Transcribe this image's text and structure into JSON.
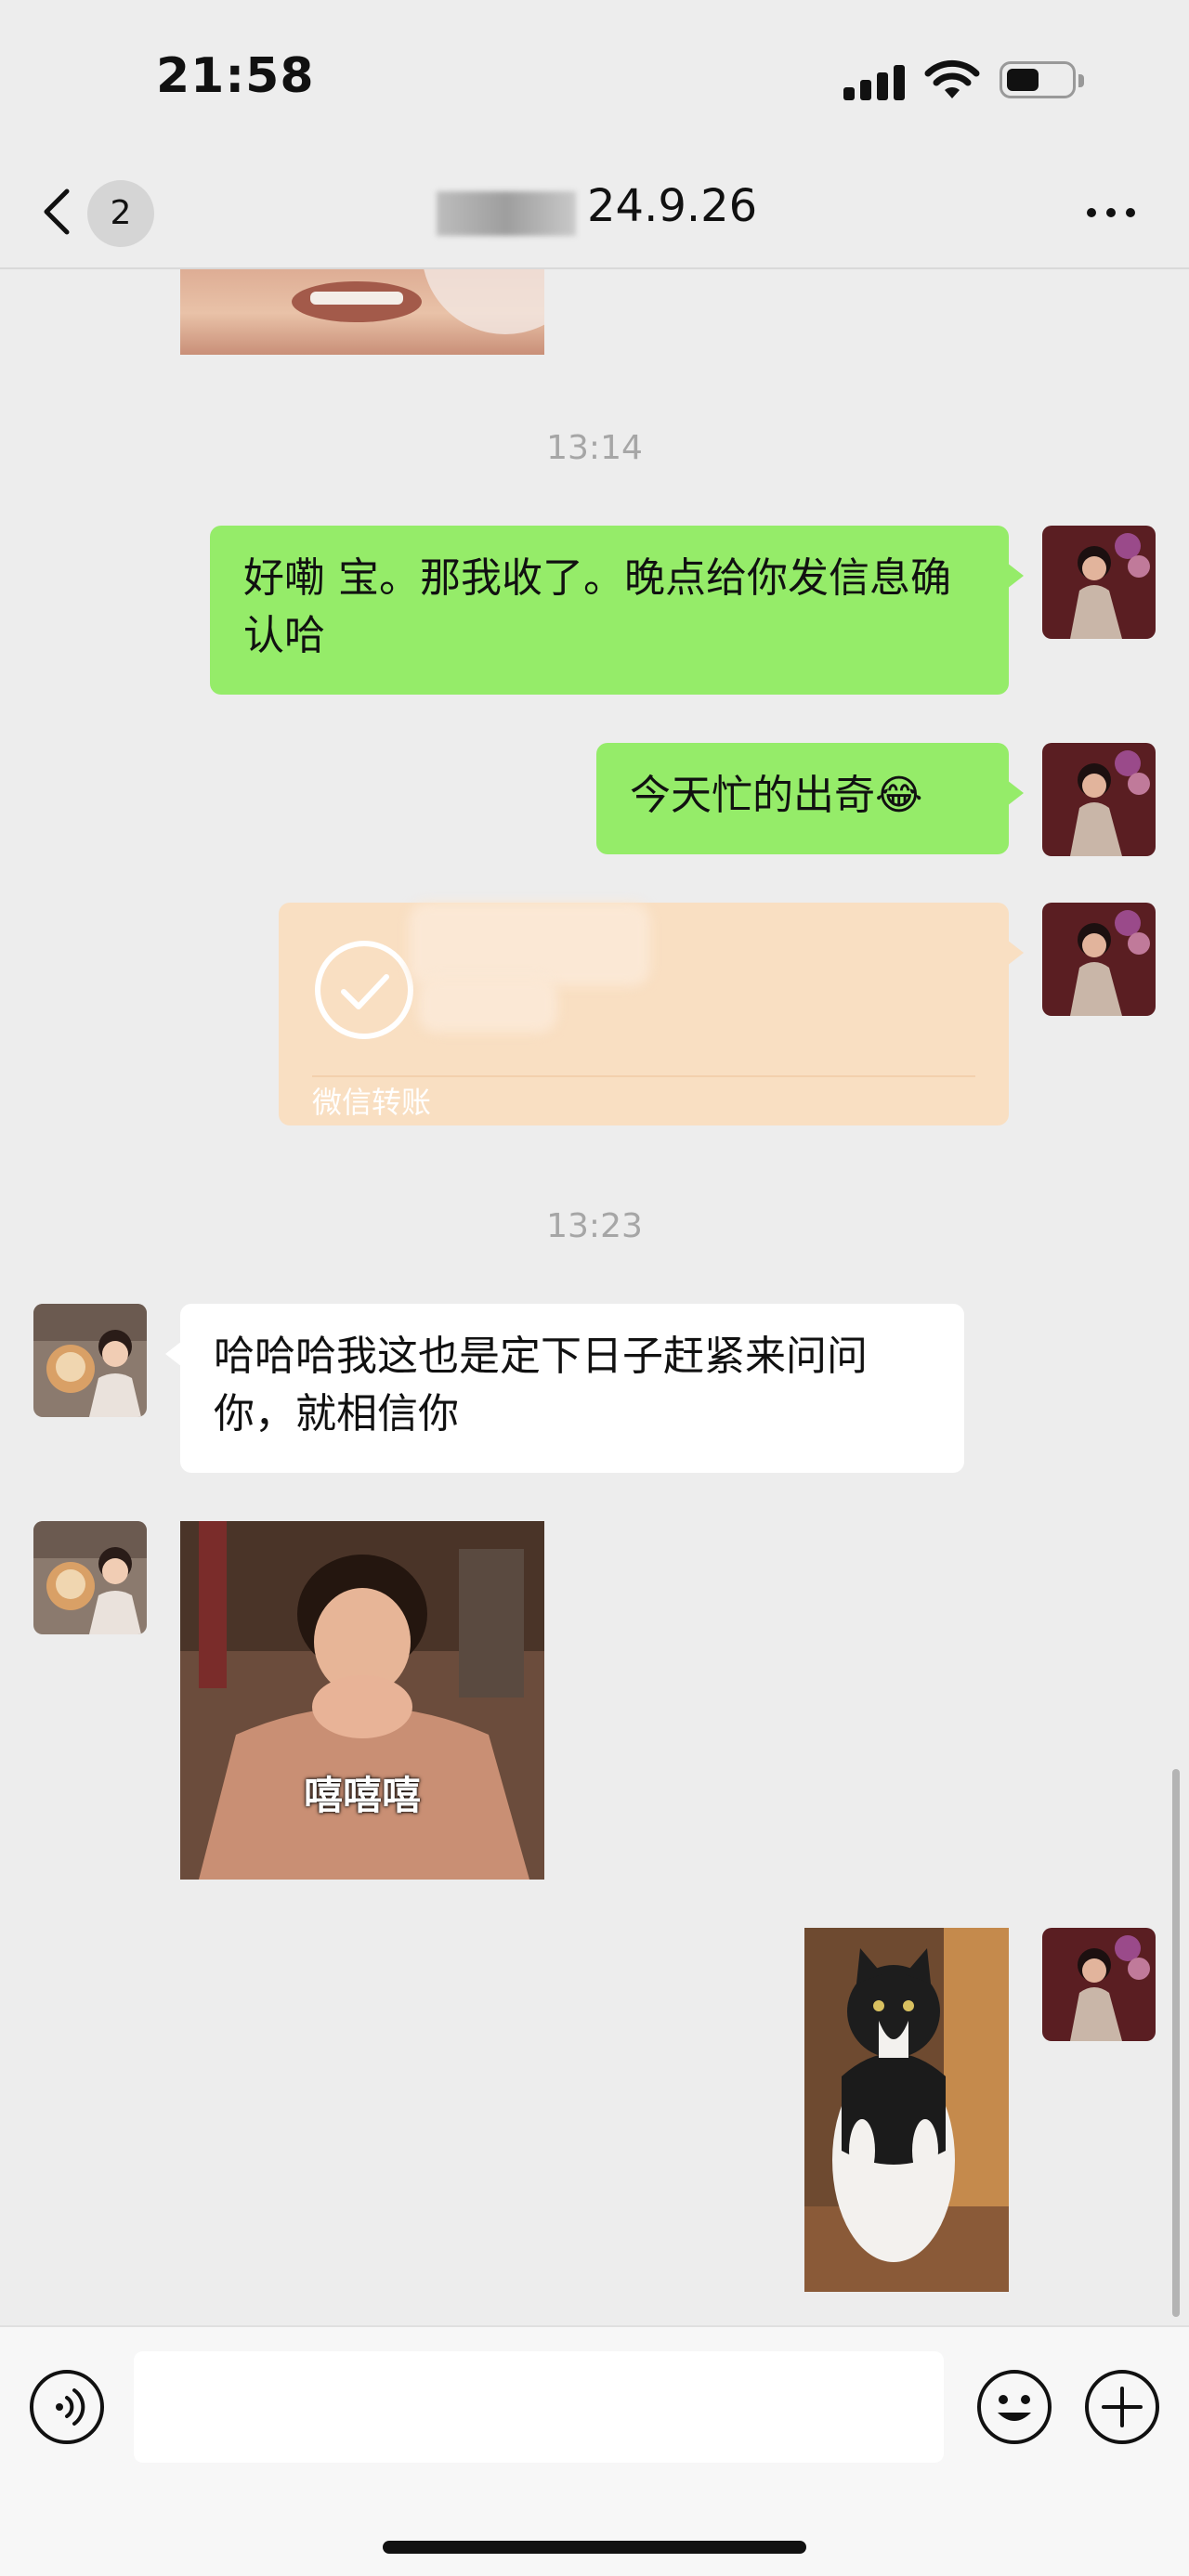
{
  "status_bar": {
    "time": "21:58"
  },
  "nav": {
    "back_badge": "2",
    "title": "24.9.26"
  },
  "messages": {
    "timestamp_1": "13:14",
    "msg_1": "好嘞 宝。那我收了。晚点给你发信息确认哈",
    "msg_2": "今天忙的出奇",
    "msg_2_emoji": "😂",
    "transfer_label": "微信转账",
    "timestamp_2": "13:23",
    "msg_3": "哈哈哈我这也是定下日子赶紧来问问你，就相信你",
    "sticker_1_caption": "嘻嘻嘻"
  },
  "icons": {
    "back": "chevron-left-icon",
    "more": "more-dots-icon",
    "voice": "voice-icon",
    "emoji": "emoji-icon",
    "plus": "plus-icon",
    "transfer": "check-circle-icon"
  },
  "colors": {
    "background": "#ededed",
    "sent_bubble": "#95ec69",
    "received_bubble": "#ffffff",
    "transfer_card": "#f9dfc2",
    "timestamp": "#a6a6a6"
  }
}
